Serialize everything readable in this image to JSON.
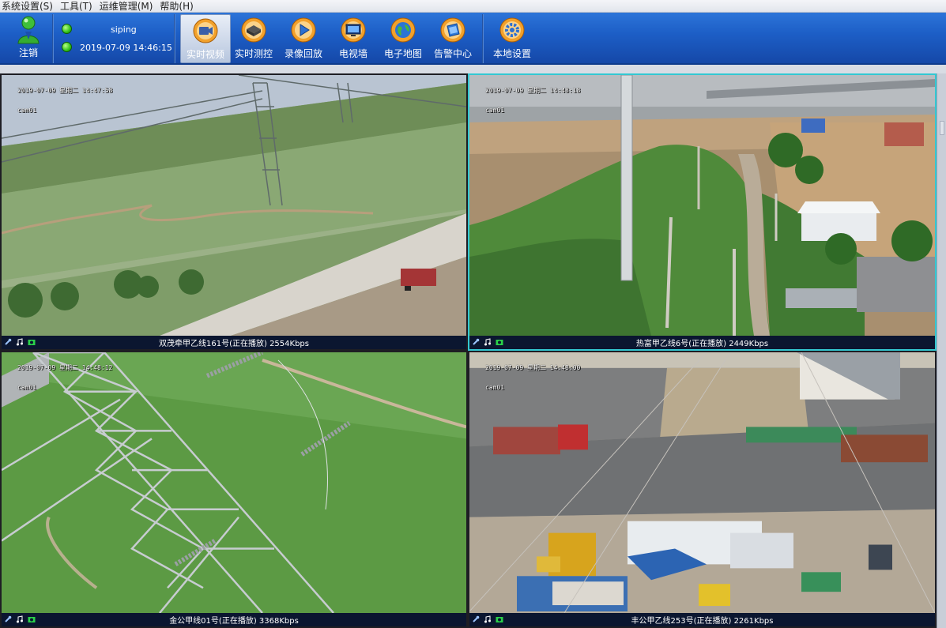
{
  "menu": [
    "系统设置(S)",
    "工具(T)",
    "运维管理(M)",
    "帮助(H)"
  ],
  "toolbar": {
    "logout_label": "注销",
    "user": "siping",
    "datetime": "2019-07-09 14:46:15",
    "buttons": [
      {
        "label": "实时视频",
        "icon": "camera-icon",
        "active": true
      },
      {
        "label": "实时测控",
        "icon": "router-icon",
        "active": false
      },
      {
        "label": "录像回放",
        "icon": "play-icon",
        "active": false
      },
      {
        "label": "电视墙",
        "icon": "monitor-icon",
        "active": false
      },
      {
        "label": "电子地图",
        "icon": "globe-icon",
        "active": false
      },
      {
        "label": "告警中心",
        "icon": "alarm-icon",
        "active": false
      },
      {
        "label": "本地设置",
        "icon": "gear-icon",
        "active": false
      }
    ]
  },
  "videos": [
    {
      "osd_time": "2019-07-09 星期二 14:47:58",
      "osd_cam": "cam01",
      "caption": "双茂牵甲乙线161号(正在播放) 2554Kbps",
      "selected": false
    },
    {
      "osd_time": "2019-07-09 星期二 14:48:18",
      "osd_cam": "cam01",
      "caption": "热富甲乙线6号(正在播放) 2449Kbps",
      "selected": true
    },
    {
      "osd_time": "2019-07-09 星期二 14:48:12",
      "osd_cam": "cam01",
      "caption": "金公甲线01号(正在播放) 3368Kbps",
      "selected": false
    },
    {
      "osd_time": "2019-07-09 星期二 14:48:00",
      "osd_cam": "cam01",
      "caption": "丰公甲乙线253号(正在播放) 2261Kbps",
      "selected": false
    }
  ],
  "colors": {
    "toolbar": "#1d5fc7",
    "selected_border": "#33c8d2",
    "status_led": "#32c21a"
  }
}
